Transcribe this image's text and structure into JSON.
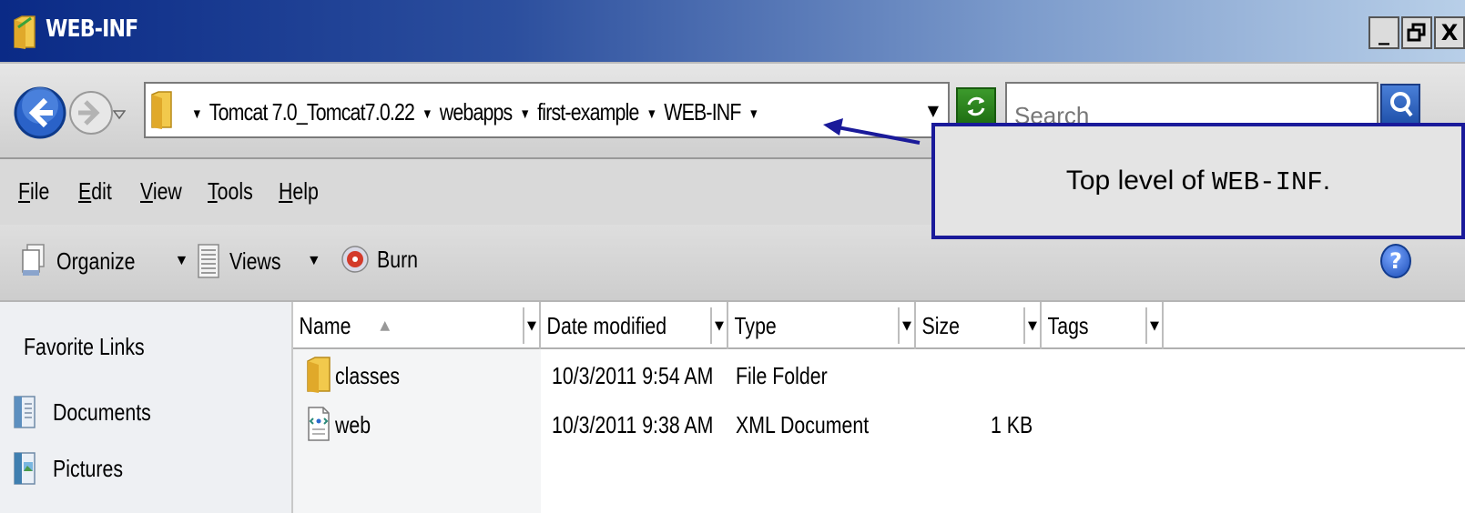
{
  "window": {
    "title": "WEB-INF",
    "buttons": {
      "minimize": "_",
      "restore": "▣",
      "close": "X"
    }
  },
  "address_bar": {
    "breadcrumbs": [
      "Tomcat 7.0_Tomcat7.0.22",
      "webapps",
      "first-example",
      "WEB-INF"
    ],
    "separator": "▼",
    "search_placeholder": "Search"
  },
  "menu": {
    "items": [
      {
        "label": "File",
        "accel": "F",
        "rest": "ile"
      },
      {
        "label": "Edit",
        "accel": "E",
        "rest": "dit"
      },
      {
        "label": "View",
        "accel": "V",
        "rest": "iew"
      },
      {
        "label": "Tools",
        "accel": "T",
        "rest": "ools"
      },
      {
        "label": "Help",
        "accel": "H",
        "rest": "elp"
      }
    ]
  },
  "toolbar": {
    "organize_label": "Organize",
    "views_label": "Views",
    "burn_label": "Burn",
    "dropdown_glyph": "▼",
    "help_glyph": "?"
  },
  "nav_pane": {
    "title": "Favorite Links",
    "items": [
      {
        "label": "Documents",
        "icon": "documents-icon"
      },
      {
        "label": "Pictures",
        "icon": "pictures-icon"
      }
    ]
  },
  "file_list": {
    "columns": [
      "Name",
      "Date modified",
      "Type",
      "Size",
      "Tags"
    ],
    "sort_glyph": "▲",
    "rows": [
      {
        "name": "classes",
        "date": "10/3/2011 9:54 AM",
        "type": "File Folder",
        "size": "",
        "icon": "folder-icon"
      },
      {
        "name": "web",
        "date": "10/3/2011 9:38 AM",
        "type": "XML Document",
        "size": "1 KB",
        "icon": "xml-file-icon"
      }
    ]
  },
  "callout": {
    "prefix": "Top level of ",
    "code": "WEB-INF",
    "suffix": "."
  },
  "colors": {
    "title_gradient_start": "#0a2a86",
    "title_gradient_end": "#b8cfe8",
    "callout_border": "#1a1a9a",
    "callout_bg": "#e4e4e4"
  }
}
